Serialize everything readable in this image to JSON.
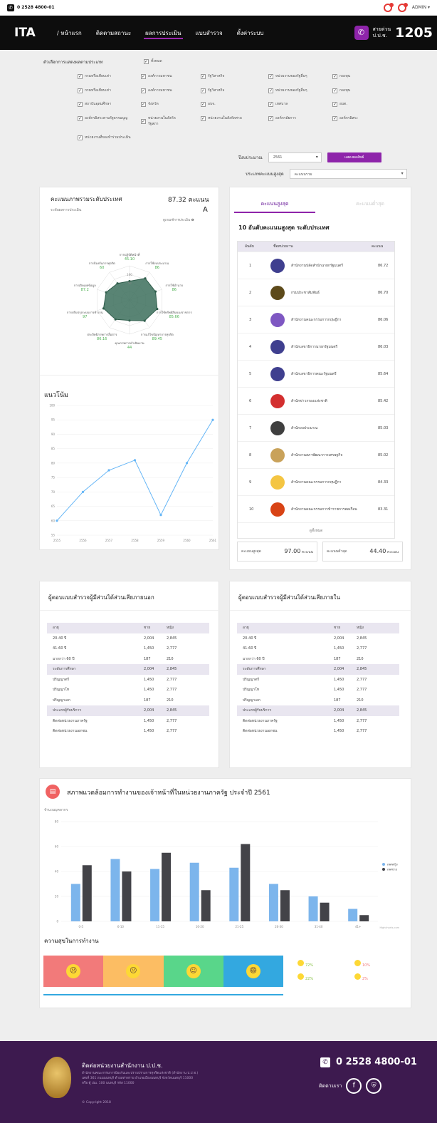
{
  "topbar": {
    "phone": "0 2528 4800-01",
    "user": "ADMIN ▾"
  },
  "nav": {
    "logo": "ITA",
    "items": [
      "/ หน้าแรก",
      "ติดตามสถานะ",
      "ผลการประเมิน",
      "แบบสำรวจ",
      "ตั้งค่าระบบ"
    ],
    "active_index": 2,
    "hotline_label1": "สายด่วน",
    "hotline_label2": "ป.ป.ช.",
    "hotline_number": "1205"
  },
  "filter": {
    "title": "ตัวเลือกการแสดงผลตามประเภท",
    "all_label": "ทั้งหมด",
    "col1": [
      "กรมหรือเทียบเท่า",
      "กรมหรือเทียบเท่า",
      "สถาบันอุดมศึกษา",
      "องค์กรอิสระตามรัฐธรรมนูญ",
      "หน่วยงานที่ขอเข้าร่วมประเมิน"
    ],
    "col2": [
      "องค์การมหาชน",
      "องค์การมหาชน",
      "จังหวัด",
      "หน่วยงานในสังกัดรัฐสภา"
    ],
    "col3": [
      "รัฐวิสาหกิจ",
      "รัฐวิสาหกิจ",
      "อบจ.",
      "หน่วยงานในสังกัดศาล"
    ],
    "col4": [
      "หน่วยงานของรัฐอื่นๆ",
      "หน่วยงานของรัฐอื่นๆ",
      "เทศบาล",
      "องค์กรอัยการ"
    ],
    "col5": [
      "กองทุน",
      "กองทุน",
      "อบต.",
      "องค์กรอิสระ"
    ],
    "year_label": "ปีงบประมาณ",
    "year_value": "2561",
    "type_label": "ประเภทคะแนนสูงสุด",
    "type_value": "คะแนนรวม",
    "button": "แสดงผลลัพธ์"
  },
  "score_panel": {
    "title": "คะแนนภาพรวมระดับประเทศ",
    "score": "87.32 คะแนน",
    "level_label": "ระดับผลการประเมิน",
    "level": "A",
    "criteria_link": "ดูเกณฑ์การประเมิน ❶"
  },
  "radar": {
    "labels": [
      {
        "name": "การปฏิบัติหน้าที่",
        "value": "45.10"
      },
      {
        "name": "การใช้งบประมาณ",
        "value": "86"
      },
      {
        "name": "การใช้อำนาจ",
        "value": "86"
      },
      {
        "name": "การใช้ทรัพย์สินของราชการ",
        "value": "85.66"
      },
      {
        "name": "การแก้ไขปัญหาการทุจริต",
        "value": "89.45"
      },
      {
        "name": "คุณภาพการดำเนินงาน",
        "value": "44"
      },
      {
        "name": "ประสิทธิภาพการสื่อสาร",
        "value": "86.16"
      },
      {
        "name": "การปรับปรุงระบบการทำงาน",
        "value": "97"
      },
      {
        "name": "การเปิดเผยข้อมูล",
        "value": "87.2"
      },
      {
        "name": "การป้องกันการทุจริต",
        "value": "60"
      }
    ],
    "tick_labels": [
      "100",
      "50"
    ]
  },
  "trend": {
    "title": "แนวโน้ม",
    "years": [
      "2555",
      "2556",
      "2557",
      "2558",
      "2559",
      "2560",
      "2561"
    ],
    "yticks": [
      "100",
      "95",
      "90",
      "85",
      "80",
      "75",
      "70",
      "65",
      "60",
      "55"
    ]
  },
  "chart_data": [
    {
      "type": "line",
      "title": "แนวโน้ม",
      "x": [
        "2555",
        "2556",
        "2557",
        "2558",
        "2559",
        "2560",
        "2561"
      ],
      "series": [
        {
          "values": [
            60,
            70,
            77.5,
            81,
            62,
            80,
            95
          ]
        }
      ],
      "ylim": [
        55,
        100
      ],
      "color": "#64b5f6"
    },
    {
      "type": "bar",
      "title": "สภาพแวดล้อมการทำงานของเจ้าหน้าที่ในหน่วยงานภาครัฐ ประจำปี 2561",
      "ylabel": "จำนวนบุคลากร",
      "categories": [
        "0-5",
        "6-10",
        "11-15",
        "16-20",
        "21-25",
        "26-30",
        "31-40",
        "41+"
      ],
      "series": [
        {
          "name": "เพศหญิง",
          "values": [
            30,
            50,
            42,
            47,
            43,
            30,
            20,
            10
          ]
        },
        {
          "name": "เพศชาย",
          "values": [
            45,
            40,
            55,
            25,
            62,
            25,
            15,
            5
          ]
        }
      ],
      "ylim": [
        0,
        80
      ],
      "colors": [
        "#7cb5ec",
        "#434348"
      ]
    }
  ],
  "ranking": {
    "tab_high": "คะแนนสูงสุด",
    "tab_low": "คะแนนต่ำสุด",
    "title": "10 อันดับคะแนนสูงสุด ระดับประเทศ",
    "headers": [
      "อันดับ",
      "ชื่อหน่วยงาน",
      "คะแนน"
    ],
    "rows": [
      {
        "rank": "1",
        "name": "สำนักงานปลัดสำนักนายกรัฐมนตรี",
        "score": "86.72",
        "color": "#3f3f8f"
      },
      {
        "rank": "2",
        "name": "กรมประชาสัมพันธ์",
        "score": "86.70",
        "color": "#5d4a1a"
      },
      {
        "rank": "3",
        "name": "สำนักงานคณะกรรมการกฤษฎีกา",
        "score": "86.06",
        "color": "#7e57c2"
      },
      {
        "rank": "4",
        "name": "สำนักเลขาธิการนายกรัฐมนตรี",
        "score": "86.03",
        "color": "#3f3f8f"
      },
      {
        "rank": "5",
        "name": "สำนักเลขาธิการคณะรัฐมนตรี",
        "score": "85.64",
        "color": "#3f3f8f"
      },
      {
        "rank": "6",
        "name": "สำนักข่าวกรองแห่งชาติ",
        "score": "85.42",
        "color": "#d32f2f"
      },
      {
        "rank": "7",
        "name": "สำนักงบประมาณ",
        "score": "85.03",
        "color": "#3f3f3f"
      },
      {
        "rank": "8",
        "name": "สำนักงานสภาพัฒนาการเศรษฐกิจ",
        "score": "85.02",
        "color": "#c9a25a"
      },
      {
        "rank": "9",
        "name": "สำนักงานคณะกรรมการกฤษฎีกา",
        "score": "84.33",
        "color": "#f4c542"
      },
      {
        "rank": "10",
        "name": "สำนักงานคณะกรรมการข้าราชการพลเรือน",
        "score": "83.31",
        "color": "#d84315"
      }
    ],
    "view_all": "ดูทั้งหมด",
    "max_label": "คะแนนสูงสุด",
    "max_value": "97.00",
    "min_label": "คะแนนต่ำสุด",
    "min_value": "44.40",
    "unit": "คะแนน"
  },
  "stake_ext": {
    "title": "ผู้ตอบแบบสำรวจผู้มีส่วนได้ส่วนเสียภายนอก",
    "rows": [
      {
        "c1": "อายุ",
        "c2": "ชาย",
        "c3": "หญิง",
        "h": true
      },
      {
        "c1": "20-40 ปี",
        "c2": "2,004",
        "c3": "2,845"
      },
      {
        "c1": "41-60 ปี",
        "c2": "1,450",
        "c3": "2,777"
      },
      {
        "c1": "มากกว่า 60 ปี",
        "c2": "187",
        "c3": "210"
      },
      {
        "c1": "ระดับการศึกษา",
        "c2": "2,004",
        "c3": "2,845",
        "h": true
      },
      {
        "c1": "ปริญญาตรี",
        "c2": "1,450",
        "c3": "2,777"
      },
      {
        "c1": "ปริญญาโท",
        "c2": "1,450",
        "c3": "2,777"
      },
      {
        "c1": "ปริญญาเอก",
        "c2": "187",
        "c3": "210"
      },
      {
        "c1": "ประเภทผู้รับบริการ",
        "c2": "2,004",
        "c3": "2,845",
        "h": true
      },
      {
        "c1": "ติดต่อหน่วยงานภาครัฐ",
        "c2": "1,450",
        "c3": "2,777"
      },
      {
        "c1": "ติดต่อหน่วยงานเอกชน",
        "c2": "1,450",
        "c3": "2,777"
      }
    ]
  },
  "stake_int": {
    "title": "ผู้ตอบแบบสำรวจผู้มีส่วนได้ส่วนเสียภายใน",
    "rows": [
      {
        "c1": "อายุ",
        "c2": "ชาย",
        "c3": "หญิง",
        "h": true
      },
      {
        "c1": "20-40 ปี",
        "c2": "2,004",
        "c3": "2,845"
      },
      {
        "c1": "41-60 ปี",
        "c2": "1,450",
        "c3": "2,777"
      },
      {
        "c1": "มากกว่า 60 ปี",
        "c2": "187",
        "c3": "210"
      },
      {
        "c1": "ระดับการศึกษา",
        "c2": "2,004",
        "c3": "2,845",
        "h": true
      },
      {
        "c1": "ปริญญาตรี",
        "c2": "1,450",
        "c3": "2,777"
      },
      {
        "c1": "ปริญญาโท",
        "c2": "1,450",
        "c3": "2,777"
      },
      {
        "c1": "ปริญญาเอก",
        "c2": "187",
        "c3": "210"
      },
      {
        "c1": "ประเภทผู้รับบริการ",
        "c2": "2,004",
        "c3": "2,845",
        "h": true
      },
      {
        "c1": "ติดต่อหน่วยงานภาครัฐ",
        "c2": "1,450",
        "c3": "2,777"
      },
      {
        "c1": "ติดต่อหน่วยงานเอกชน",
        "c2": "1,450",
        "c3": "2,777"
      }
    ]
  },
  "environment": {
    "title": "สภาพแวดล้อมการทำงานของเจ้าหน้าที่ในหน่วยงานภาครัฐ ประจำปี 2561",
    "ylabel": "จำนวนบุคลากร",
    "yticks": [
      "80",
      "60",
      "40",
      "20",
      "0"
    ],
    "legend": [
      "เพศหญิง",
      "เพศชาย"
    ],
    "credit": "Highcharts.com"
  },
  "happiness": {
    "title": "ความสุขในการทำงาน",
    "segments": [
      {
        "color": "#f27a7a",
        "face": "☹"
      },
      {
        "color": "#fcbd63",
        "face": "😐"
      },
      {
        "color": "#59d68a",
        "face": "☺"
      },
      {
        "color": "#33a8e0",
        "face": "😄"
      }
    ],
    "stats": [
      {
        "pct": "72%",
        "color": "#8bc34a"
      },
      {
        "pct": "10%",
        "color": "#f27a7a"
      },
      {
        "pct": "22%",
        "color": "#8bc34a"
      },
      {
        "pct": "2%",
        "color": "#f27a7a"
      }
    ]
  },
  "footer": {
    "title": "ติดต่อหน่วยงานสำนักงาน ป.ป.ช.",
    "addr1": "สำนักงานคณะกรรมการป้องกันและปราบปรามการทุจริตแห่งชาติ (สำนักงาน ป.ป.ช.)",
    "addr2": "เลขที่ 361 ถนนนนทบุรี ตำบลท่าทราย อำเภอเมืองนนทบุรี จังหวัดนนทบุรี 11000",
    "addr3": "หรือ ตู้ ปณ. 100 นนทบุรี รหัส 11000",
    "copyright": "© Copyright 2018",
    "phone": "0 2528 4800-01",
    "follow": "ติดตามเรา"
  }
}
